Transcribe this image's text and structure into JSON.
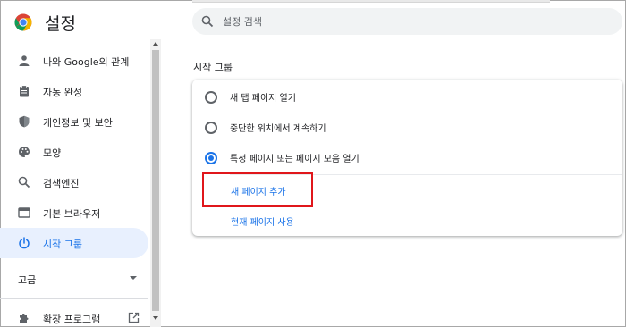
{
  "header": {
    "title": "설정",
    "search_placeholder": "설정 검색",
    "icons": {
      "logo": "chrome-logo",
      "search": "search-icon"
    }
  },
  "sidebar": {
    "items": [
      {
        "label": "나와 Google의 관계",
        "icon": "person-icon"
      },
      {
        "label": "자동 완성",
        "icon": "clipboard-icon"
      },
      {
        "label": "개인정보 및 보안",
        "icon": "shield-icon"
      },
      {
        "label": "모양",
        "icon": "palette-icon"
      },
      {
        "label": "검색엔진",
        "icon": "search-icon"
      },
      {
        "label": "기본 브라우저",
        "icon": "browser-window-icon"
      },
      {
        "label": "시작 그룹",
        "icon": "power-icon",
        "active": true
      }
    ],
    "advanced_label": "고급",
    "extensions_label": "확장 프로그램"
  },
  "main": {
    "section_title": "시작 그룹",
    "options": [
      {
        "label": "새 탭 페이지 열기",
        "selected": false
      },
      {
        "label": "중단한 위치에서 계속하기",
        "selected": false
      },
      {
        "label": "특정 페이지 또는 페이지 모음 열기",
        "selected": true
      }
    ],
    "add_page_link": "새 페이지 추가",
    "use_current_link": "현재 페이지 사용"
  },
  "colors": {
    "accent": "#1a73e8",
    "active_bg": "#e8f0fe",
    "highlight": "#e0161b",
    "search_bg": "#f1f3f4"
  }
}
